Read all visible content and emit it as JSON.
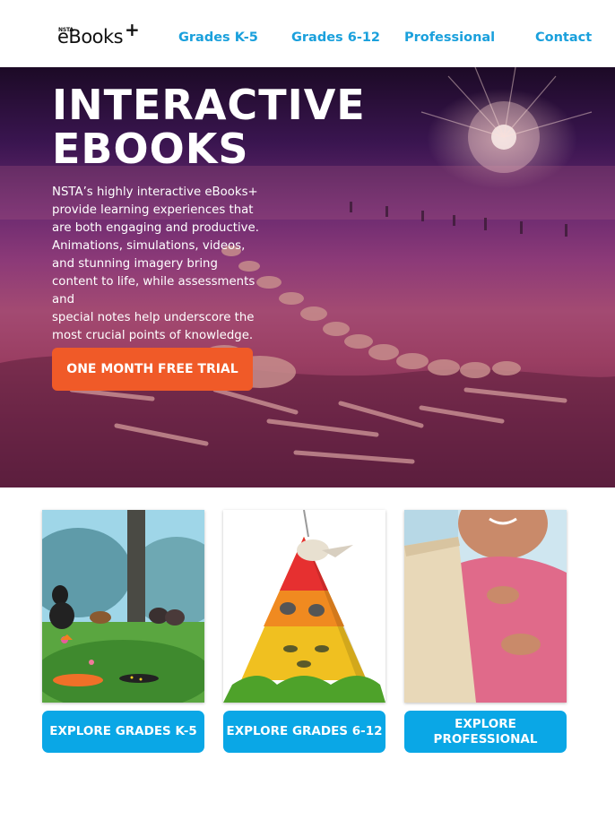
{
  "header": {
    "logo": {
      "small_text": "NSTA",
      "word": "eBooks",
      "plus": "+"
    },
    "nav": [
      {
        "label": "Grades K-5"
      },
      {
        "label": "Grades 6-12"
      },
      {
        "label": "Professional"
      },
      {
        "label": "Contact"
      }
    ]
  },
  "hero": {
    "title_lines": [
      "INTERACTIVE",
      "EBOOKS"
    ],
    "description_lines": [
      "NSTA’s highly interactive eBooks+",
      "provide learning experiences that",
      "are both engaging and productive.",
      "Animations, simulations, videos,",
      "and stunning imagery bring",
      "content to life, while assessments",
      "and",
      "special notes help underscore the",
      "most crucial points of knowledge."
    ],
    "cta_label": "ONE MONTH FREE TRIAL"
  },
  "cards": [
    {
      "image": "forest-animals-illustration",
      "button_lines": [
        "EXPLORE GRADES K-5"
      ]
    },
    {
      "image": "food-pyramid-illustration",
      "button_lines": [
        "EXPLORE GRADES 6-12"
      ]
    },
    {
      "image": "student-tablet-photo",
      "button_lines": [
        "EXPLORE",
        "PROFESSIONAL"
      ]
    }
  ],
  "colors": {
    "nav": "#1aa0dc",
    "cta": "#f05a28",
    "card_button": "#0aa7e6"
  }
}
